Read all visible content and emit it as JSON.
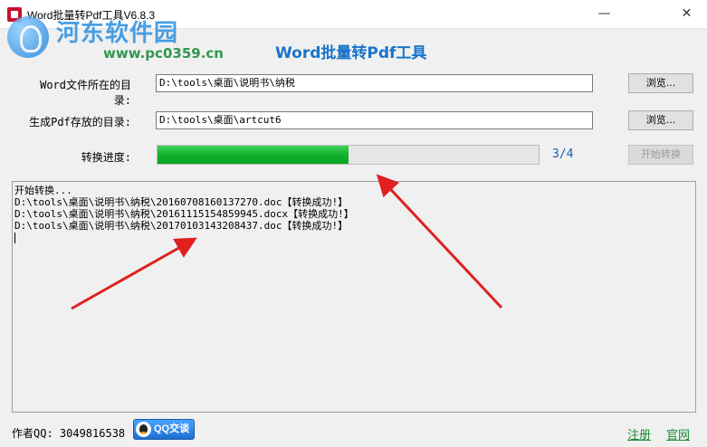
{
  "window": {
    "title": "Word批量转Pdf工具V6.8.3",
    "minimize_icon": "minimize-icon",
    "close_icon": "close-icon"
  },
  "watermark": {
    "site_name": "河东软件园",
    "url": "www.pc0359.cn"
  },
  "heading": "Word批量转Pdf工具",
  "form": {
    "word_dir_label": "Word文件所在的目录:",
    "word_dir_value": "D:\\tools\\桌面\\说明书\\纳税",
    "pdf_dir_label": "生成Pdf存放的目录:",
    "pdf_dir_value": "D:\\tools\\桌面\\artcut6",
    "browse_label": "浏览...",
    "progress_label": "转换进度:",
    "progress_count": "3/4",
    "progress_fraction": 0.5,
    "start_label": "开始转换"
  },
  "log": {
    "lines": [
      "开始转换...",
      "D:\\tools\\桌面\\说明书\\纳税\\20160708160137270.doc【转换成功!】",
      "D:\\tools\\桌面\\说明书\\纳税\\20161115154859945.docx【转换成功!】",
      "D:\\tools\\桌面\\说明书\\纳税\\20170103143208437.doc【转换成功!】"
    ]
  },
  "footer": {
    "author": "作者QQ: 3049816538",
    "qq_button": "QQ交谈",
    "register": "注册",
    "official_site": "官网"
  },
  "colors": {
    "heading": "#1a73c9",
    "progress": "#12b02d",
    "link": "#1a8a2e",
    "annotation_arrow": "#e02020"
  }
}
